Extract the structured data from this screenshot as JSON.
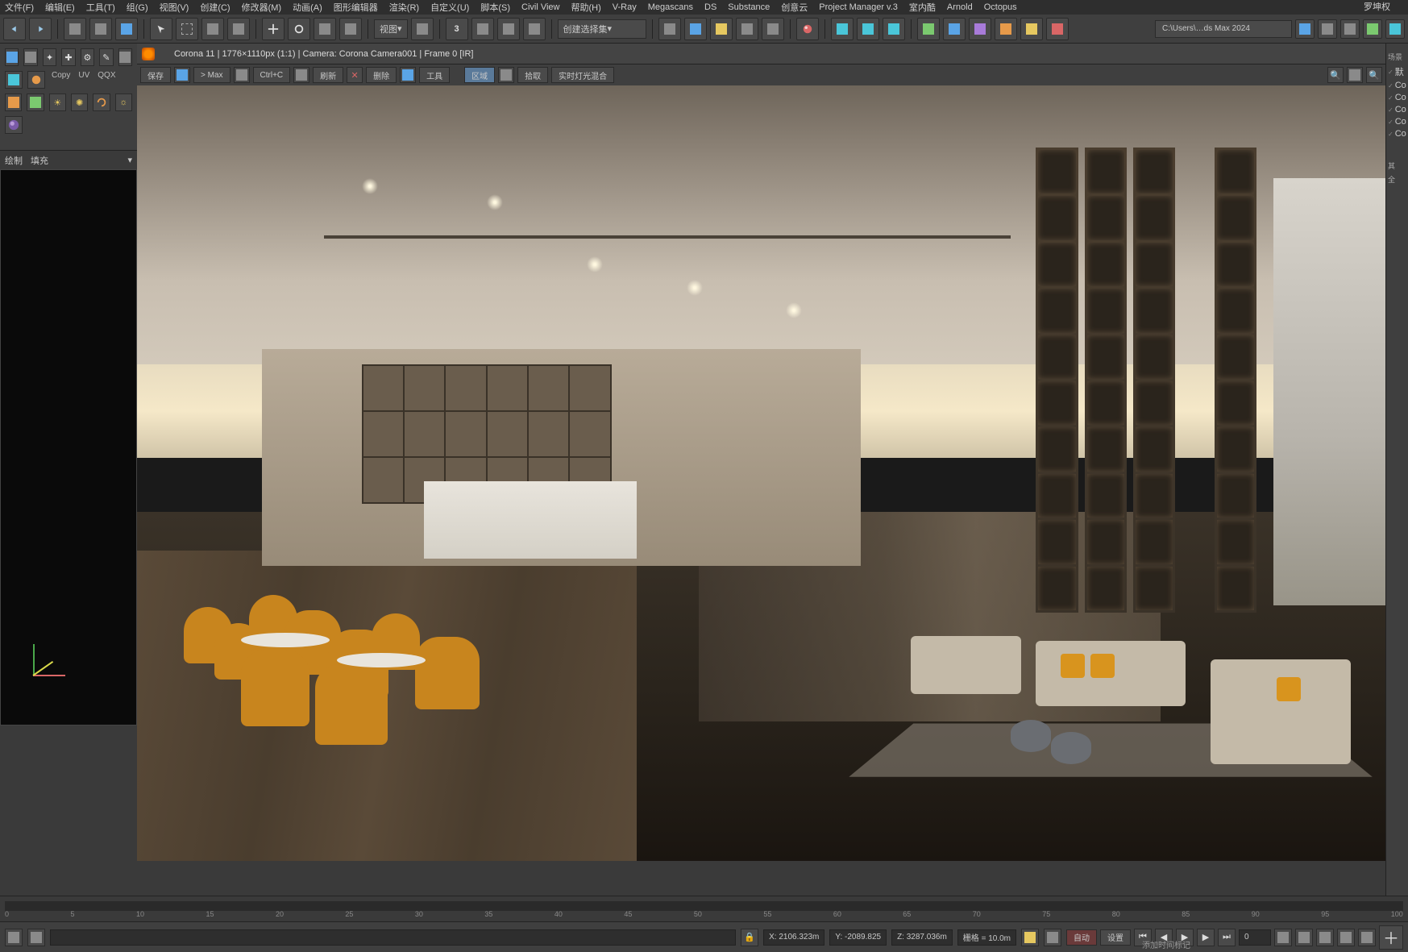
{
  "app_title": "罗坤权",
  "menu": {
    "items": [
      "文件(F)",
      "编辑(E)",
      "工具(T)",
      "组(G)",
      "视图(V)",
      "创建(C)",
      "修改器(M)",
      "动画(A)",
      "图形编辑器",
      "渲染(R)",
      "自定义(U)",
      "脚本(S)",
      "Civil View",
      "帮助(H)",
      "V-Ray",
      "Megascans",
      "DS",
      "Substance",
      "创意云",
      "Project Manager v.3",
      "室内酷",
      "Arnold",
      "Octopus"
    ]
  },
  "main_toolbar": {
    "view_dropdown": "视图",
    "selset_dropdown": "创建选择集",
    "path": "C:\\Users\\…ds Max 2024"
  },
  "left_tools": {
    "copy": "Copy",
    "uv": "UV",
    "qqx": "QQX",
    "sub_l": "绘制",
    "sub_r": "填充"
  },
  "render_window": {
    "title": "Corona 11 | 1776×1110px (1:1) | Camera: Corona Camera001 | Frame 0 [IR]"
  },
  "render_toolbar": {
    "save": "保存",
    "max": "> Max",
    "ctrlc": "Ctrl+C",
    "refresh": "刷新",
    "delete": "删除",
    "tools": "工具",
    "region": "区域",
    "pick": "拾取",
    "realtime": "实时灯光混合"
  },
  "right_panel": {
    "header": "场景",
    "items": [
      "默",
      "Co",
      "Co",
      "Co",
      "Co",
      "Co"
    ],
    "footer1": "其",
    "footer2": "全"
  },
  "timeline": {
    "ticks": [
      "0",
      "5",
      "10",
      "15",
      "20",
      "25",
      "30",
      "35",
      "40",
      "45",
      "50",
      "55",
      "60",
      "65",
      "70",
      "75",
      "80",
      "85",
      "90",
      "95",
      "100"
    ]
  },
  "status": {
    "x": "X: 2106.323m",
    "y": "Y: -2089.825",
    "z": "Z: 3287.036m",
    "grid": "栅格 = 10.0m",
    "autokey": "自动",
    "setkey": "设置",
    "time_label": "添加时间标记"
  }
}
